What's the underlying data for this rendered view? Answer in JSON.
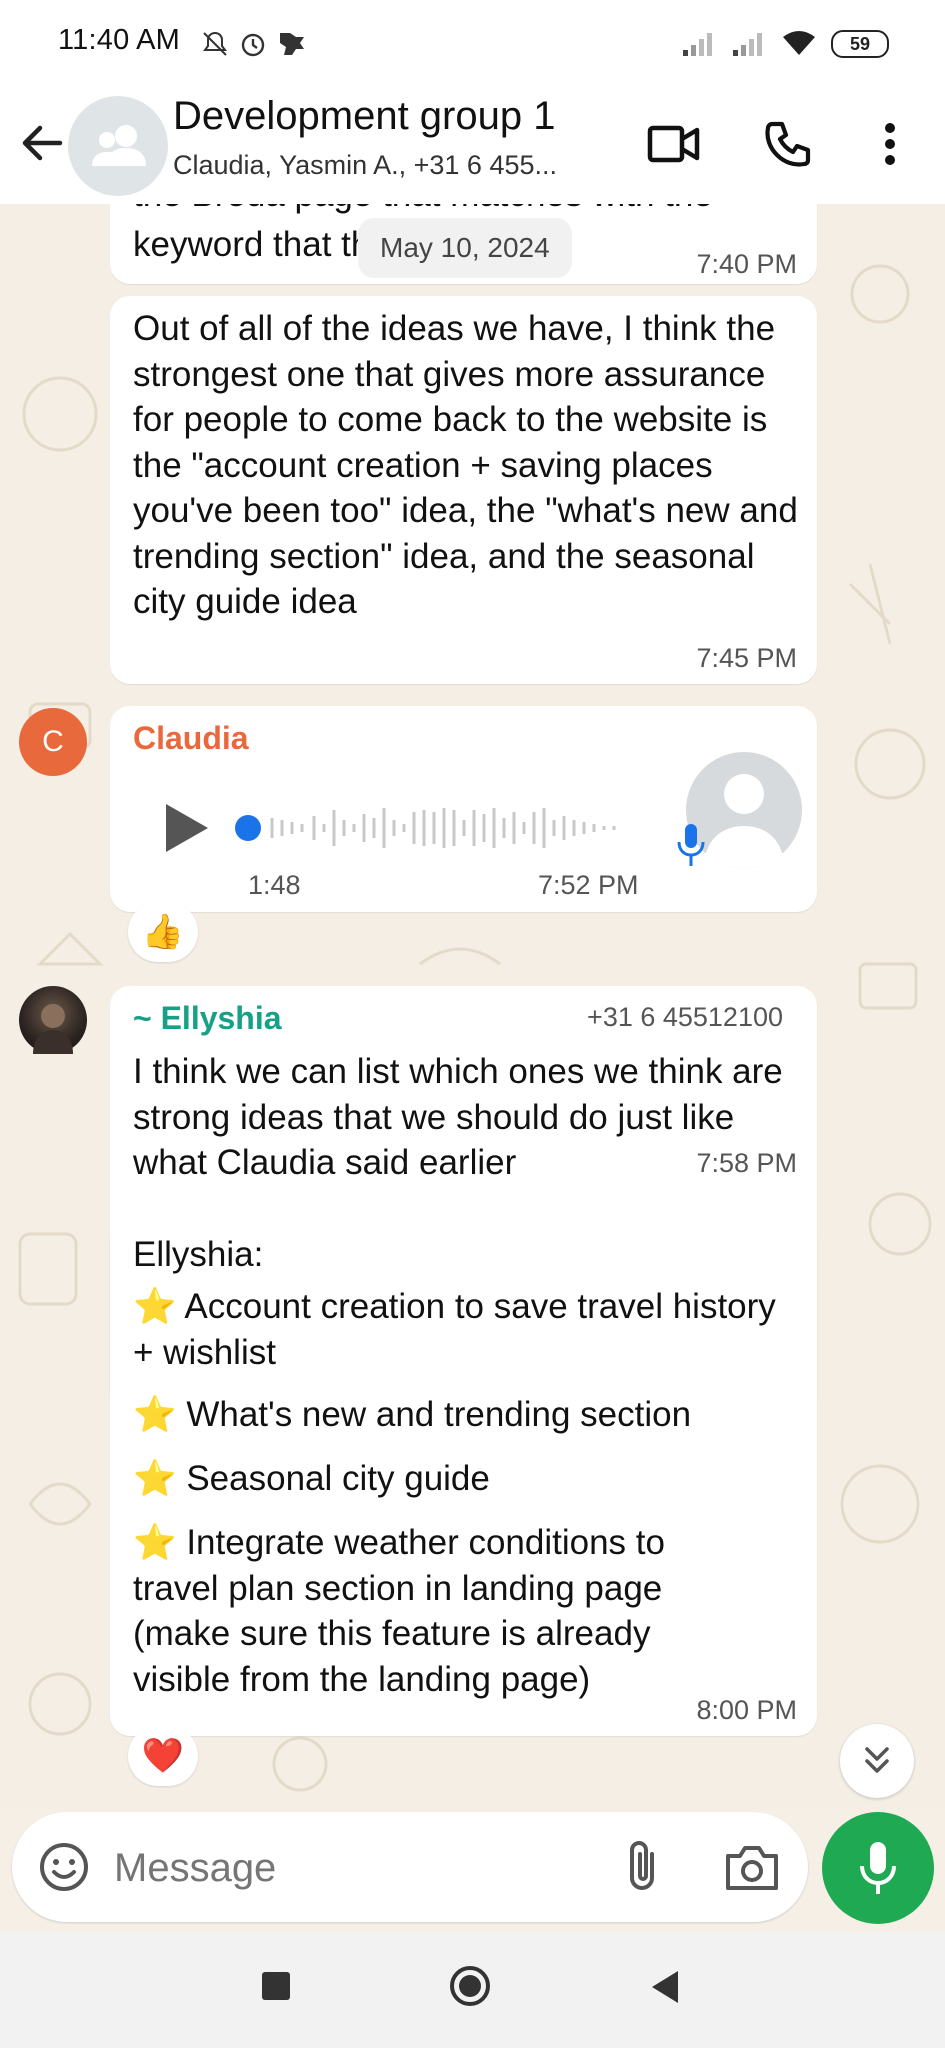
{
  "status_bar": {
    "time": "11:40 AM",
    "battery": "59"
  },
  "header": {
    "title": "Development group 1",
    "subtitle": "Claudia, Yasmin A., +31 6 455..."
  },
  "chat": {
    "date_chip": "May 10, 2024",
    "msg1": {
      "partial_line": "the Breda page that matches with the",
      "text": "keyword that they typed in",
      "time": "7:40 PM"
    },
    "msg2": {
      "text": "Out of all of the ideas we have, I think the strongest one that gives more assurance for people to come back to the website is the \"account creation + saving places you've been too\" idea, the \"what's new and trending section\" idea, and the seasonal city guide idea",
      "time": "7:45 PM"
    },
    "voice": {
      "avatar_letter": "C",
      "sender": "Claudia",
      "duration": "1:48",
      "time": "7:52 PM",
      "reaction": "👍"
    },
    "msg3": {
      "sender": "~ Ellyshia",
      "phone": "+31 6 45512100",
      "text": "I think we can list which ones we think are strong ideas that we should do just like what Claudia said earlier",
      "time": "7:58 PM"
    },
    "msg4": {
      "intro": "Ellyshia:",
      "items": [
        "Account creation to save travel history + wishlist",
        "What's new and trending section",
        "Seasonal city guide",
        "Integrate weather conditions to travel plan section in landing page (make sure this feature is already visible from the landing page)"
      ],
      "star": "⭐",
      "time": "8:00 PM",
      "reaction": "❤️"
    }
  },
  "composer": {
    "placeholder": "Message"
  },
  "colors": {
    "accent_green": "#1ea952",
    "claudia": "#e8693c",
    "ellyshia": "#16a085",
    "voice_dot": "#1a73e8"
  }
}
